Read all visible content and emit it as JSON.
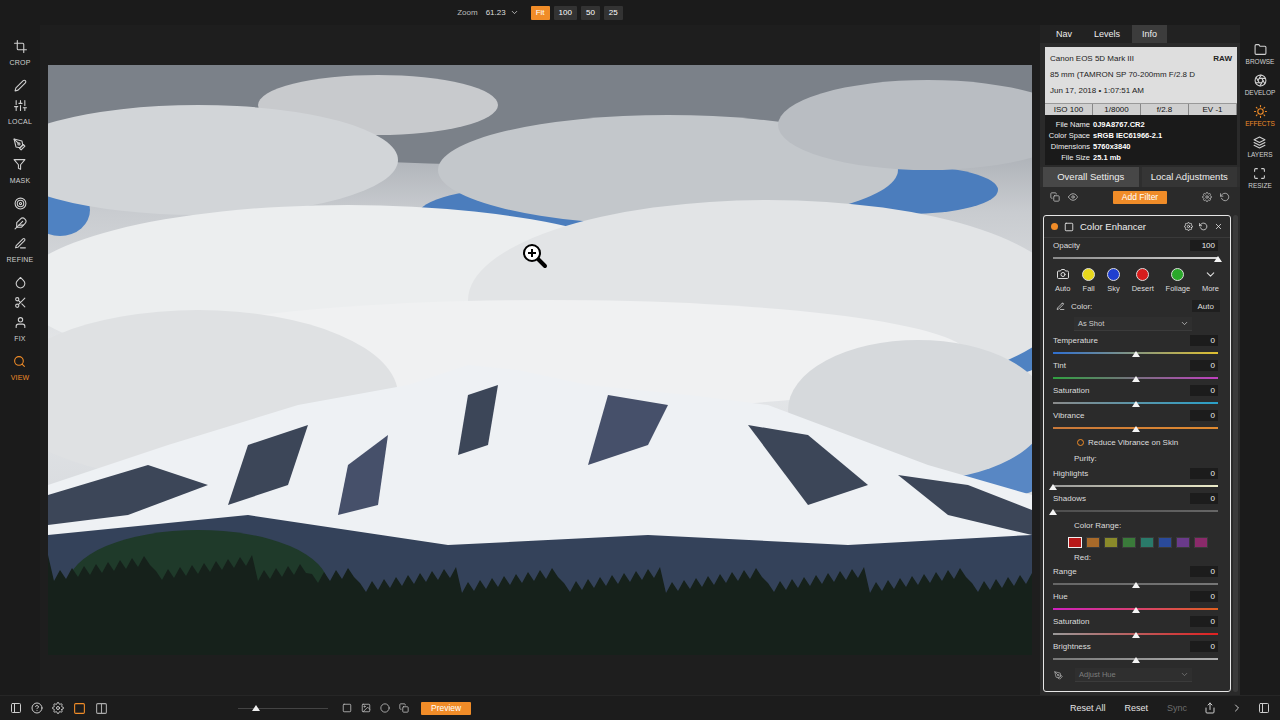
{
  "top_bar": {
    "zoom_label": "Zoom",
    "zoom_value": "61.23",
    "zoom_presets": [
      {
        "label": "Fit",
        "selected": true
      },
      {
        "label": "100",
        "selected": false
      },
      {
        "label": "50",
        "selected": false
      },
      {
        "label": "25",
        "selected": false
      }
    ]
  },
  "left_tools": [
    {
      "label": "CROP",
      "selected": false
    },
    {
      "label": "LOCAL",
      "selected": false
    },
    {
      "label": "MASK",
      "selected": false
    },
    {
      "label": "REFINE",
      "selected": false
    },
    {
      "label": "FIX",
      "selected": false
    },
    {
      "label": "VIEW",
      "selected": true
    }
  ],
  "panel_tabs": [
    {
      "label": "Nav",
      "selected": false
    },
    {
      "label": "Levels",
      "selected": false
    },
    {
      "label": "Info",
      "selected": true
    }
  ],
  "info": {
    "camera": "Canon EOS 5D Mark III",
    "format": "RAW",
    "lens": "85 mm (TAMRON SP 70-200mm F/2.8 D",
    "date": "Jun 17, 2018 • 1:07:51 AM",
    "exposure": [
      "ISO 100",
      "1/8000",
      "f/2.8",
      "EV -1"
    ],
    "fields": [
      {
        "label": "File Name",
        "value": "0J9A8767.CR2"
      },
      {
        "label": "Color Space",
        "value": "sRGB IEC61966-2.1"
      },
      {
        "label": "Dimensions",
        "value": "5760x3840"
      },
      {
        "label": "File Size",
        "value": "25.1 mb"
      }
    ]
  },
  "settings_tabs": [
    {
      "label": "Overall Settings",
      "selected": true
    },
    {
      "label": "Local Adjustments",
      "selected": false
    }
  ],
  "add_filter": "Add Filter",
  "filter": {
    "title": "Color Enhancer",
    "enabled": true,
    "opacity": {
      "label": "Opacity",
      "value": "100",
      "level": 1,
      "colors": [
        "#8a8a8a",
        "#d6d6d6"
      ]
    },
    "presets": [
      {
        "kind": "auto",
        "label": "Auto"
      },
      {
        "kind": "swatch",
        "label": "Fall",
        "color": "#e8d81c"
      },
      {
        "kind": "swatch",
        "label": "Sky",
        "color": "#1f3fd0"
      },
      {
        "kind": "swatch",
        "label": "Desert",
        "color": "#d81c1c"
      },
      {
        "kind": "swatch",
        "label": "Foliage",
        "color": "#2aa82a"
      },
      {
        "kind": "more",
        "label": "More"
      }
    ],
    "color": {
      "label": "Color:",
      "mode": "Auto",
      "preset": "As Shot"
    },
    "controls": [
      {
        "kind": "slider",
        "label": "Temperature",
        "value": "0",
        "level": 0.5,
        "colors": [
          "#2f6fd0",
          "#e0c030"
        ]
      },
      {
        "kind": "slider",
        "label": "Tint",
        "value": "0",
        "level": 0.5,
        "colors": [
          "#30a040",
          "#c040c0"
        ]
      },
      {
        "kind": "slider",
        "label": "Saturation",
        "value": "0",
        "level": 0.5,
        "colors": [
          "#8a8a8a",
          "#2aa0c8"
        ]
      },
      {
        "kind": "slider",
        "label": "Vibrance",
        "value": "0",
        "level": 0.5,
        "colors": [
          "#c8783a",
          "#e08a30"
        ]
      },
      {
        "kind": "checkbox",
        "label": "Reduce Vibrance on Skin",
        "checked": false
      },
      {
        "kind": "heading",
        "label": "Purity:"
      },
      {
        "kind": "slider",
        "label": "Highlights",
        "value": "0",
        "level": 0,
        "colors": [
          "#9a9a9a",
          "#ecebc8"
        ]
      },
      {
        "kind": "slider",
        "label": "Shadows",
        "value": "0",
        "level": 0,
        "colors": [
          "#4e4e4e",
          "#666666"
        ]
      },
      {
        "kind": "heading",
        "label": "Color Range:"
      },
      {
        "kind": "swatches",
        "items": [
          {
            "color": "#b81818",
            "selected": true
          },
          {
            "color": "#a86a2a",
            "selected": false
          },
          {
            "color": "#8a8a2a",
            "selected": false
          },
          {
            "color": "#3a7a3a",
            "selected": false
          },
          {
            "color": "#2a7a6a",
            "selected": false
          },
          {
            "color": "#2a4a9a",
            "selected": false
          },
          {
            "color": "#6a3a8a",
            "selected": false
          },
          {
            "color": "#8a2a6a",
            "selected": false
          }
        ]
      },
      {
        "kind": "heading",
        "label": "Red:"
      },
      {
        "kind": "slider",
        "label": "Range",
        "value": "0",
        "level": 0.5,
        "colors": [
          "#666666",
          "#777777"
        ]
      },
      {
        "kind": "slider",
        "label": "Hue",
        "value": "0",
        "level": 0.5,
        "colors": [
          "#d020c0",
          "#e06020"
        ]
      },
      {
        "kind": "slider",
        "label": "Saturation",
        "value": "0",
        "level": 0.5,
        "colors": [
          "#999999",
          "#e02020"
        ]
      },
      {
        "kind": "slider",
        "label": "Brightness",
        "value": "0",
        "level": 0.5,
        "colors": [
          "#777777",
          "#b0b0b0"
        ]
      }
    ],
    "adjust": {
      "label": "Adjust Hue",
      "disabled": true
    }
  },
  "modules": [
    {
      "label": "BROWSE",
      "selected": false
    },
    {
      "label": "DEVELOP",
      "selected": false
    },
    {
      "label": "EFFECTS",
      "selected": true
    },
    {
      "label": "LAYERS",
      "selected": false
    },
    {
      "label": "RESIZE",
      "selected": false
    }
  ],
  "bottom_bar": {
    "layouts": [
      {
        "selected": true
      },
      {
        "selected": false
      }
    ],
    "thumb_level": 0.2,
    "preview": "Preview",
    "buttons": [
      {
        "label": "Reset All",
        "disabled": false
      },
      {
        "label": "Reset",
        "disabled": false
      },
      {
        "label": "Sync",
        "disabled": true
      }
    ]
  }
}
